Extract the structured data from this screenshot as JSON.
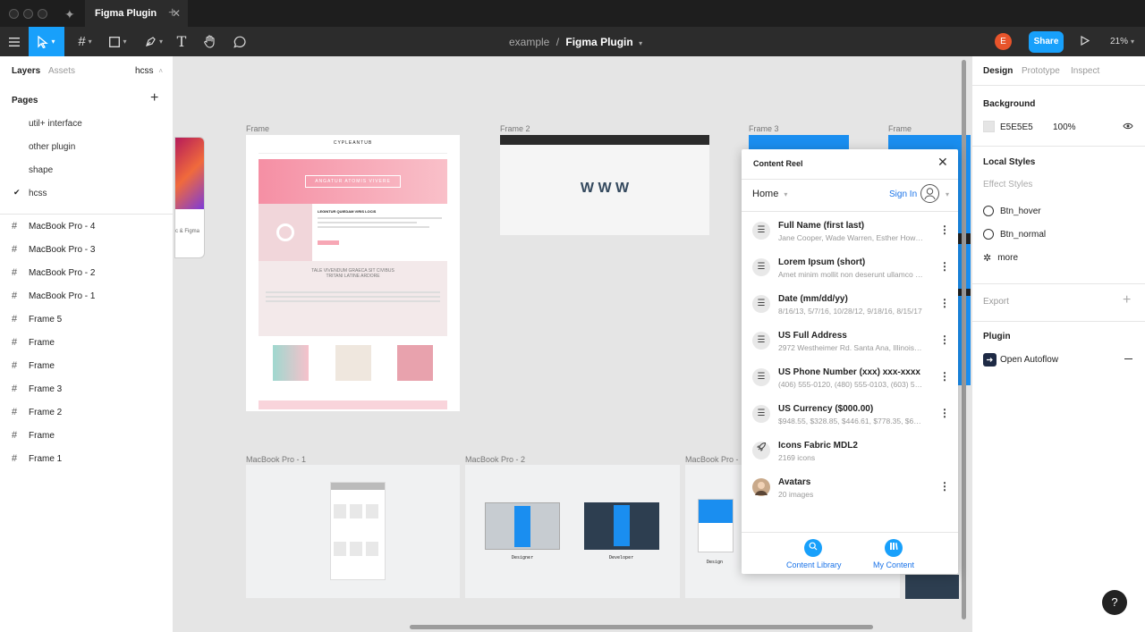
{
  "titlebar": {
    "tab_label": "Figma Plugin",
    "tab_close": "✕",
    "tab_add": "+"
  },
  "toolbar": {
    "breadcrumb_project": "example",
    "breadcrumb_sep": "/",
    "breadcrumb_file": "Figma Plugin",
    "avatar_letter": "E",
    "share_label": "Share",
    "zoom": "21%"
  },
  "left_panel": {
    "tabs": [
      "Layers",
      "Assets"
    ],
    "page_selector": "hcss",
    "pages_title": "Pages",
    "pages": [
      "util+ interface",
      "other plugin",
      "shape",
      "hcss"
    ],
    "layers": [
      "MacBook Pro - 4",
      "MacBook Pro - 3",
      "MacBook Pro - 2",
      "MacBook Pro - 1",
      "Frame 5",
      "Frame",
      "Frame",
      "Frame 3",
      "Frame 2",
      "Frame",
      "Frame 1"
    ]
  },
  "canvas": {
    "frame_labels": [
      "Frame",
      "Frame 2",
      "Frame 3",
      "Frame",
      "MacBook Pro - 1",
      "MacBook Pro - 2",
      "MacBook Pro -"
    ],
    "frame1": {
      "brand": "CYPLEANTUB",
      "hero": "ANGATUR ATOMIS VIVERE",
      "heading": "LEGINTUR QUIEDAM VIRIS LOCIS",
      "section": "TALE VIVENDUM GRAECA SIT CIVIBUS",
      "section2": "TRITANI LATINE ARDORE"
    },
    "frame2": {
      "text": "W W W"
    },
    "mb2_labels": [
      "Designer",
      "Developer"
    ],
    "mb3_label": "Design",
    "partial_label": "c & Figma"
  },
  "plugin": {
    "title": "Content Reel",
    "nav_home": "Home",
    "sign_in": "Sign In",
    "items": [
      {
        "title": "Full Name (first last)",
        "subtitle": "Jane Cooper, Wade Warren, Esther Howard",
        "icon": "list-icon"
      },
      {
        "title": "Lorem Ipsum (short)",
        "subtitle": "Amet minim mollit non deserunt ullamco est",
        "icon": "list-icon"
      },
      {
        "title": "Date (mm/dd/yy)",
        "subtitle": "8/16/13, 5/7/16, 10/28/12, 9/18/16, 8/15/17",
        "icon": "list-icon"
      },
      {
        "title": "US Full Address",
        "subtitle": "2972 Westheimer Rd. Santa Ana, Illinois 85486",
        "icon": "list-icon"
      },
      {
        "title": "US Phone Number (xxx) xxx-xxxx",
        "subtitle": "(406) 555-0120, (480) 555-0103, (603) 555-0123",
        "icon": "list-icon"
      },
      {
        "title": "US Currency ($000.00)",
        "subtitle": "$948.55, $328.85, $446.61, $778.35, $630.44",
        "icon": "list-icon"
      },
      {
        "title": "Icons Fabric MDL2",
        "subtitle": "2169 icons",
        "icon": "rocket-icon"
      },
      {
        "title": "Avatars",
        "subtitle": "20 images",
        "icon": "avatar-icon"
      }
    ],
    "footer": {
      "library": "Content Library",
      "my_content": "My Content"
    }
  },
  "right_panel": {
    "tabs": [
      "Design",
      "Prototype",
      "Inspect"
    ],
    "background_title": "Background",
    "background_color": "E5E5E5",
    "background_opacity": "100%",
    "local_styles_title": "Local Styles",
    "effect_styles": "Effect Styles",
    "styles": [
      "Btn_hover",
      "Btn_normal"
    ],
    "more": "more",
    "export_title": "Export",
    "plugin_title": "Plugin",
    "plugin_name": "Open Autoflow"
  },
  "help_label": "?"
}
